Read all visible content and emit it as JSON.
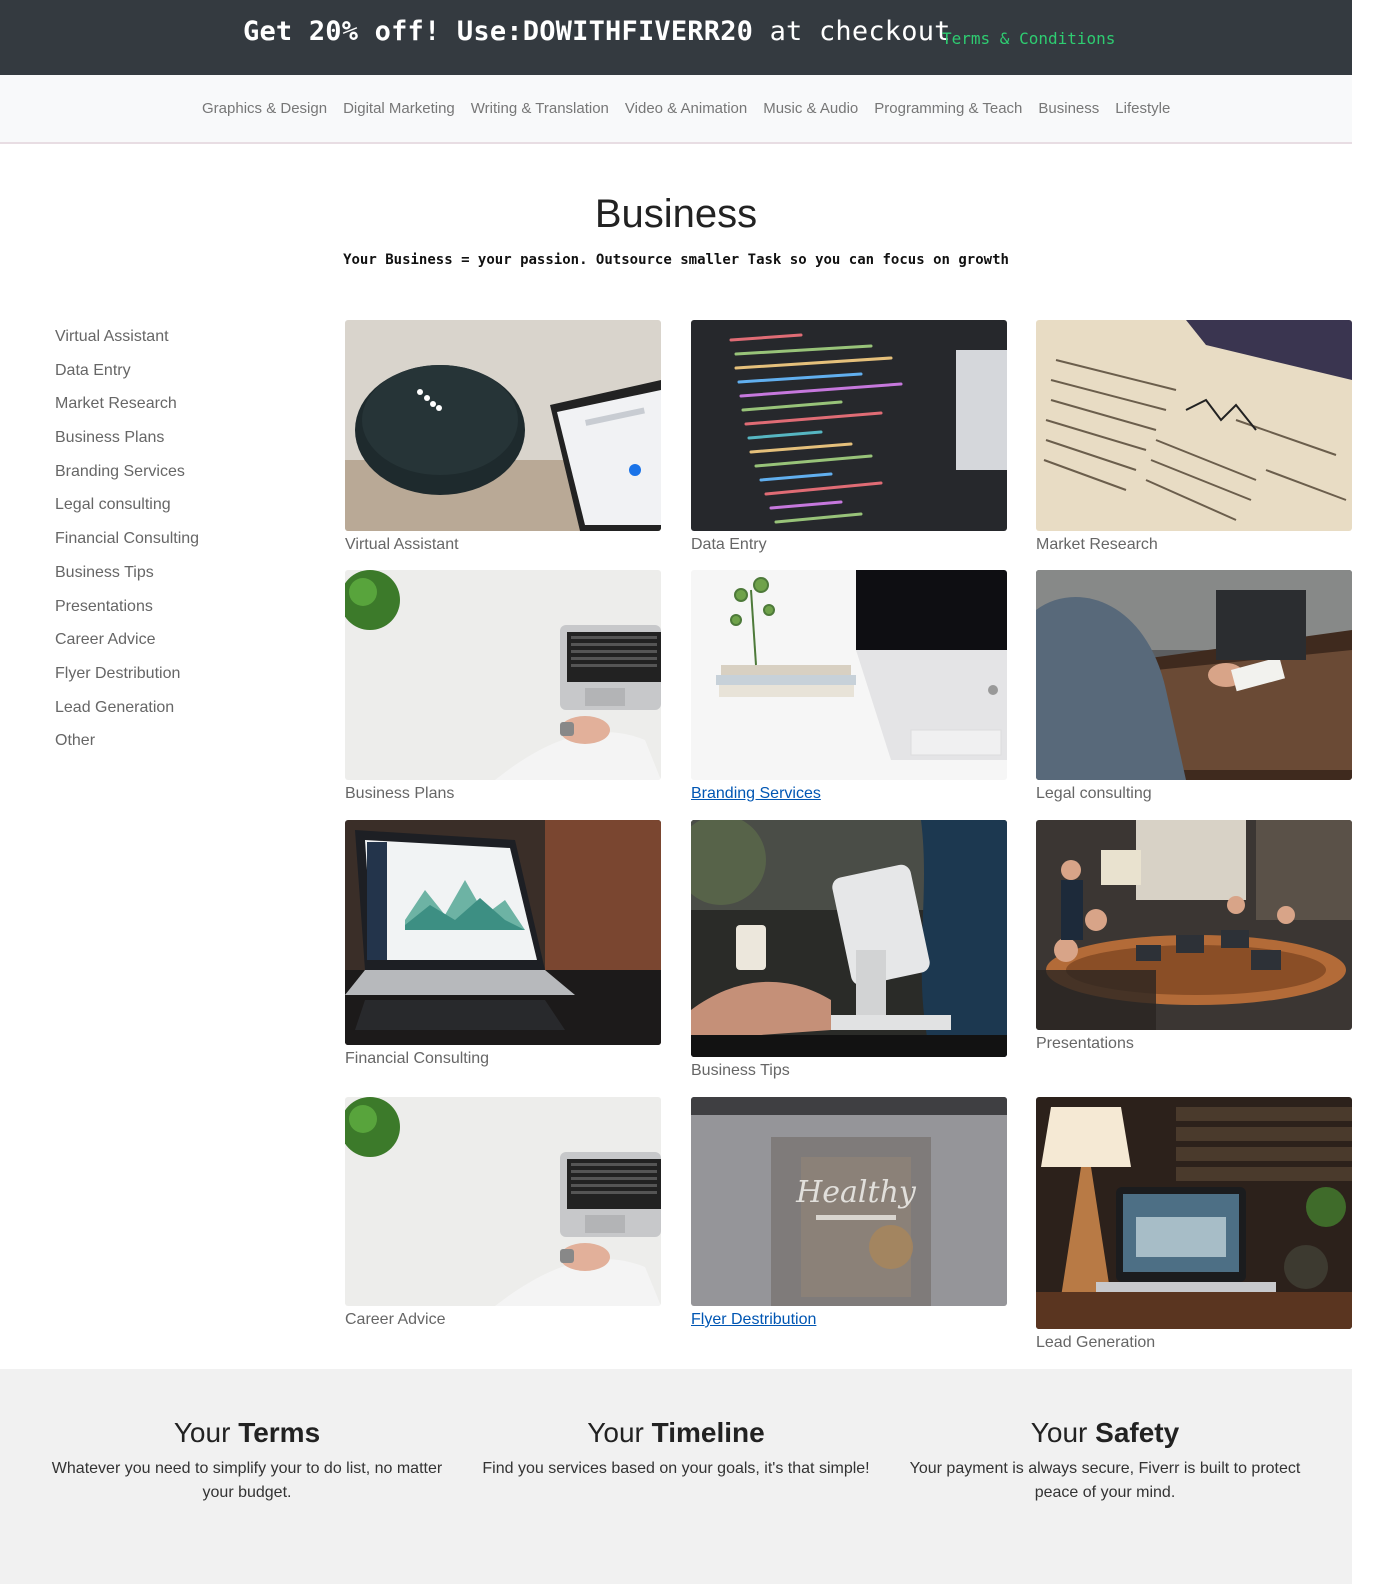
{
  "promo": {
    "prefix": "Get 20% off! Use:",
    "code": "DOWITHFIVERR20",
    "suffix": " at checkout",
    "terms_link": "Terms & Conditions"
  },
  "category_nav": [
    "Graphics & Design",
    "Digital Marketing",
    "Writing & Translation",
    "Video & Animation",
    "Music & Audio",
    "Programming & Teach",
    "Business",
    "Lifestyle"
  ],
  "hero": {
    "title": "Business",
    "subtitle": "Your Business = your passion. Outsource smaller Task so you can focus on growth"
  },
  "sidebar": [
    "Virtual Assistant",
    "Data Entry",
    "Market Research",
    "Business Plans",
    "Branding Services",
    "Legal consulting",
    "Financial Consulting",
    "Business Tips",
    "Presentations",
    "Career Advice",
    "Flyer Destribution",
    "Lead Generation",
    "Other"
  ],
  "cards": [
    {
      "label": "Virtual Assistant",
      "photo": "smart-speaker-and-phone"
    },
    {
      "label": "Data Entry",
      "photo": "code-on-screen"
    },
    {
      "label": "Market Research",
      "photo": "newspaper"
    },
    {
      "label": "Business Plans",
      "photo": "laptop-on-white-desk"
    },
    {
      "label": "Branding Services",
      "photo": "white-desk-with-imac"
    },
    {
      "label": "Legal consulting",
      "photo": "meeting-at-table"
    },
    {
      "label": "Financial Consulting",
      "photo": "laptop-with-charts"
    },
    {
      "label": "Business Tips",
      "photo": "card-payment-terminal"
    },
    {
      "label": "Presentations",
      "photo": "conference-room"
    },
    {
      "label": "Career Advice",
      "photo": "laptop-on-white-desk"
    },
    {
      "label": "Flyer Destribution",
      "photo": "healthy-organic-food-poster",
      "photo_text": "Healthy"
    },
    {
      "label": "Lead Generation",
      "photo": "laptop-and-lamp"
    }
  ],
  "features": [
    {
      "title_light": "Your ",
      "title_bold": "Terms",
      "desc": "Whatever you need to simplify your to do list, no matter your budget."
    },
    {
      "title_light": "Your ",
      "title_bold": "Timeline",
      "desc": "Find you services based on your goals, it's that simple!"
    },
    {
      "title_light": "Your ",
      "title_bold": "Safety",
      "desc": "Your payment is always secure, Fiverr is built to protect peace of your mind."
    }
  ]
}
